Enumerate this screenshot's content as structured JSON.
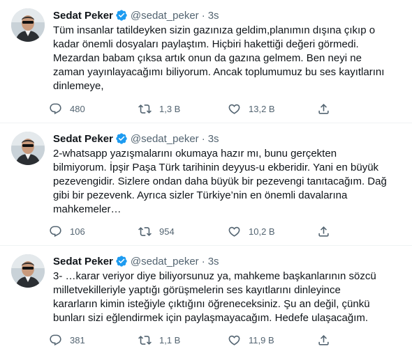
{
  "tweets": [
    {
      "author": {
        "name": "Sedat Peker",
        "handle": "@sedat_peker",
        "verified": true
      },
      "time": "3s",
      "text_lines": [
        "Tüm insanlar tatildeyken sizin gazınıza geldim,planımın dışına çıkıp o",
        "kadar önemli dosyaları paylaştım. Hiçbiri hakettiği değeri görmedi.",
        "Mezardan babam çıksa artık onun da gazına gelmem. Ben neyi ne",
        "zaman yayınlayacağımı biliyorum. Ancak toplumumuz bu ses kayıtlarını",
        "dinlemeye,"
      ],
      "replies": "480",
      "retweets": "1,3 B",
      "likes": "13,2 B"
    },
    {
      "author": {
        "name": "Sedat Peker",
        "handle": "@sedat_peker",
        "verified": true
      },
      "time": "3s",
      "text_lines": [
        "2-whatsapp yazışmalarını okumaya hazır mı, bunu gerçekten",
        "bilmiyorum. İpşir Paşa Türk tarihinin deyyus-u ekberidir. Yani en büyük",
        "pezevengidir. Sizlere ondan daha büyük bir pezevengi tanıtacağım. Dağ",
        "gibi bir pezevenk. Ayrıca sizler Türkiye’nin en önemli davalarına",
        "mahkemeler…"
      ],
      "replies": "106",
      "retweets": "954",
      "likes": "10,2 B"
    },
    {
      "author": {
        "name": "Sedat Peker",
        "handle": "@sedat_peker",
        "verified": true
      },
      "time": "3s",
      "text_lines": [
        "3- …karar veriyor diye biliyorsunuz ya, mahkeme başkanlarının sözcü",
        "milletvekilleriyle yaptığı görüşmelerin ses kayıtlarını dinleyince",
        "kararların kimin isteğiyle çıktığını öğreneceksiniz. Şu an değil, çünkü",
        "bunları sizi eğlendirmek için paylaşmayacağım. Hedefe ulaşacağım."
      ],
      "replies": "381",
      "retweets": "1,1 B",
      "likes": "11,9 B"
    }
  ],
  "icons": {
    "reply": "reply-icon",
    "retweet": "retweet-icon",
    "like": "like-icon",
    "share": "share-icon",
    "verified": "verified-badge-icon"
  },
  "colors": {
    "verified": "#1d9bf0",
    "text": "#0f1419",
    "secondary": "#536471",
    "divider": "#eff3f4"
  }
}
